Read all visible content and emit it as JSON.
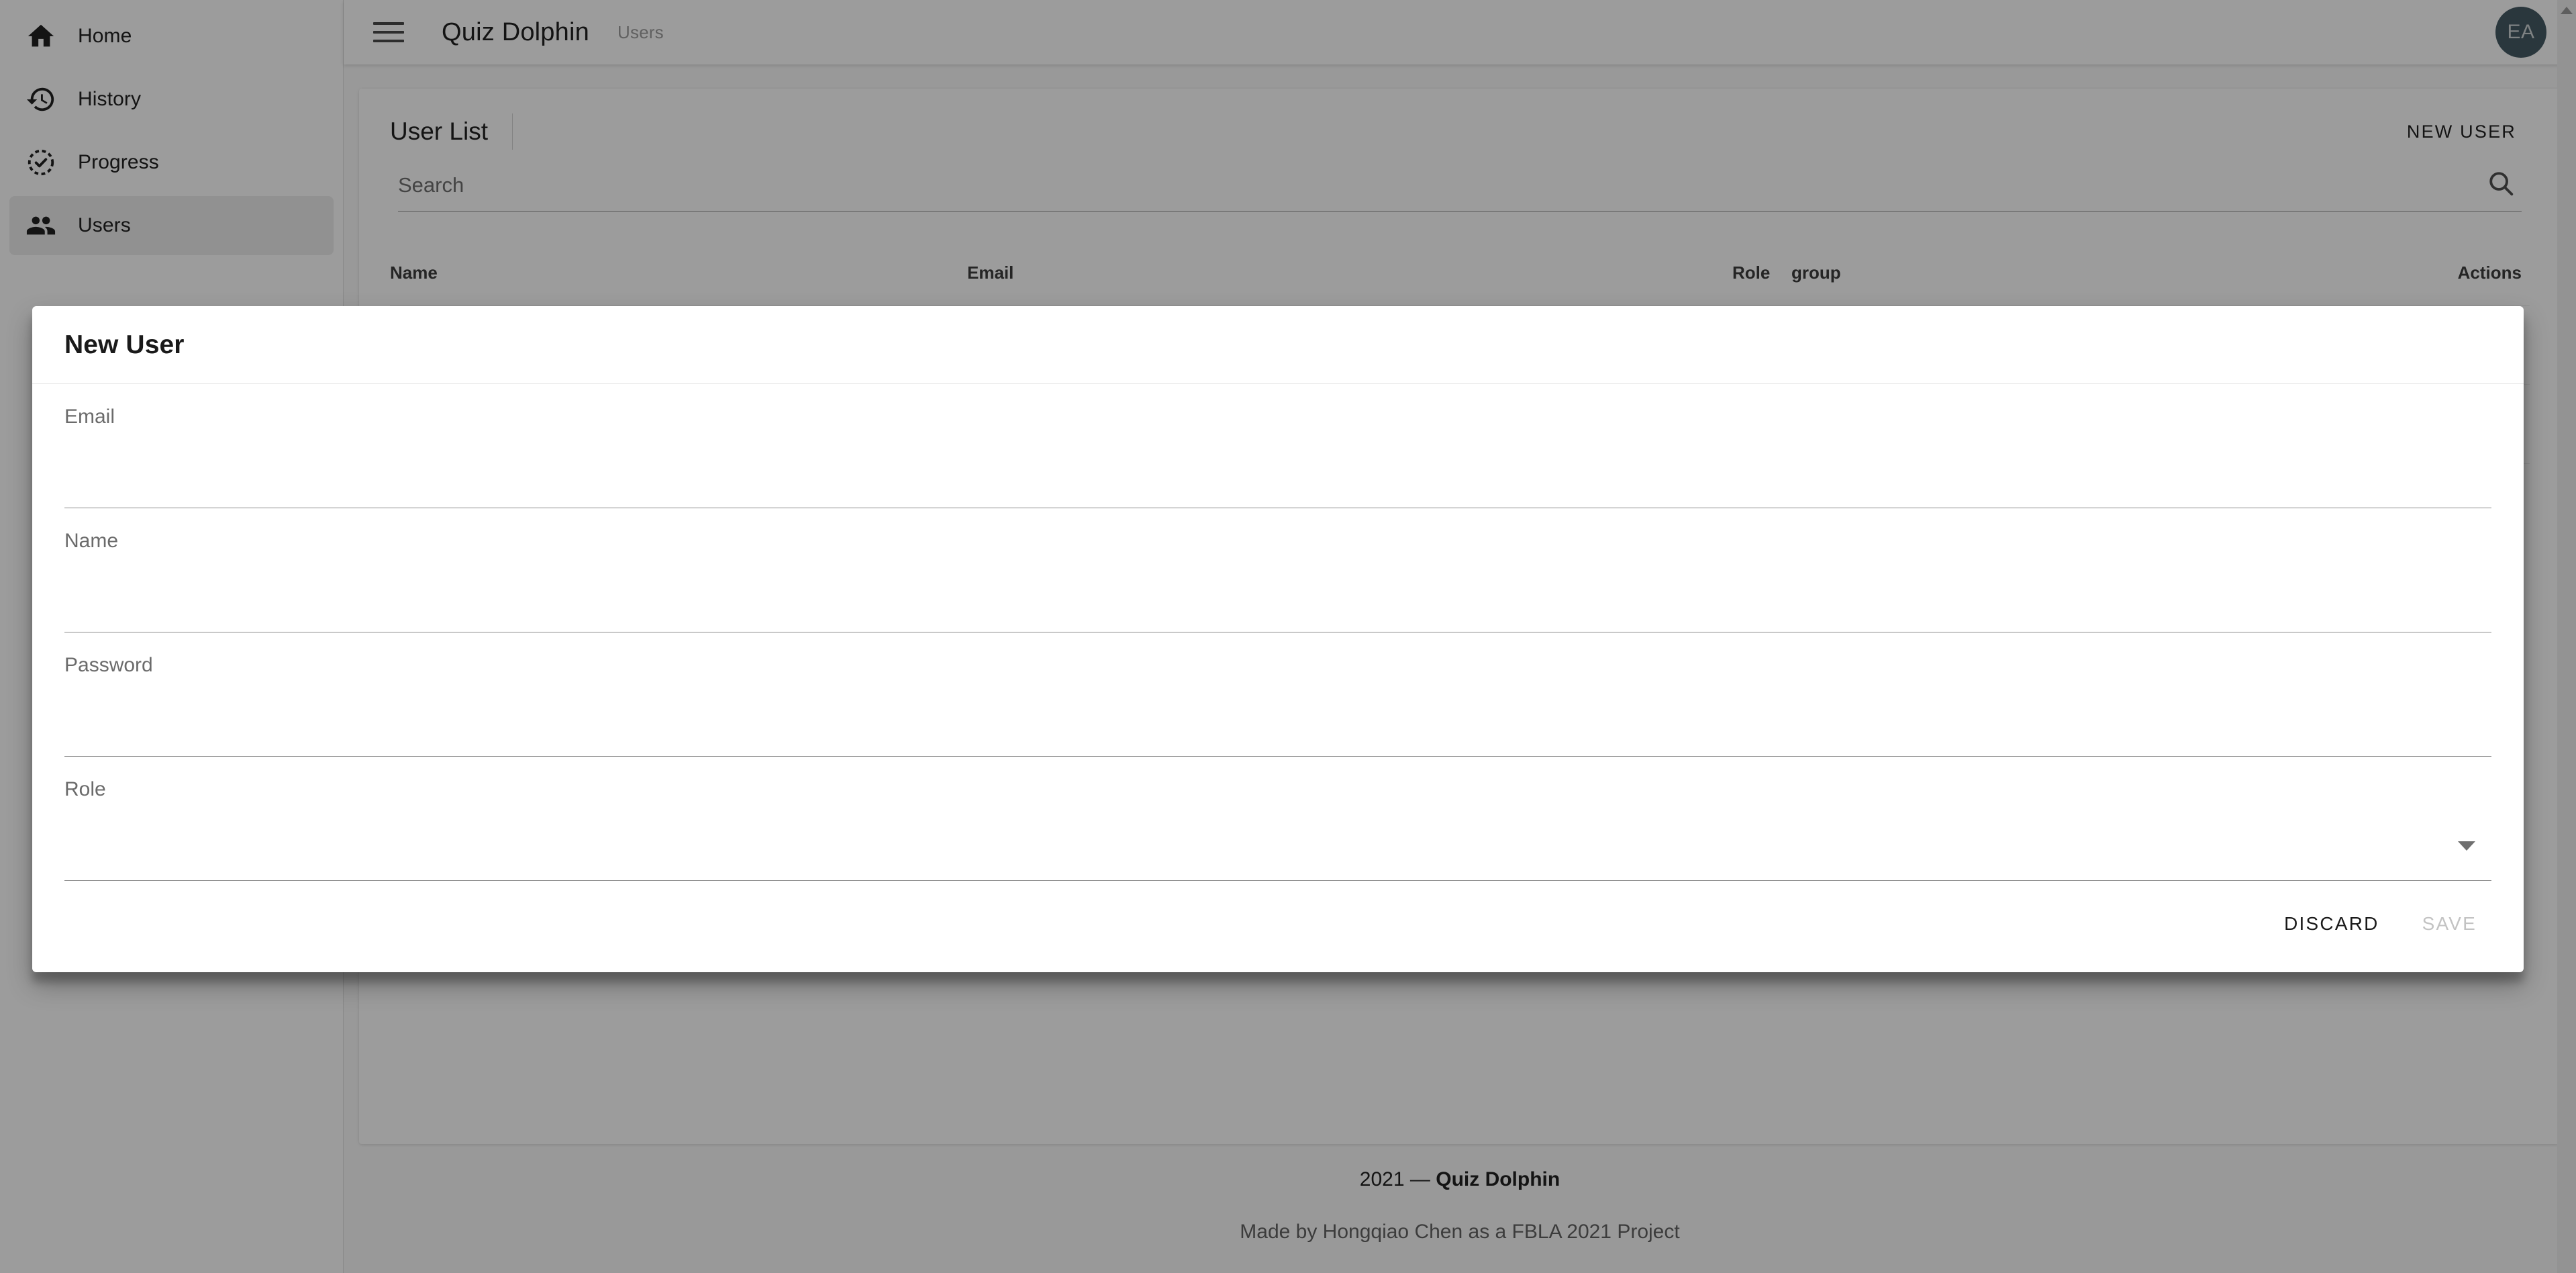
{
  "sidebar": {
    "items": [
      {
        "label": "Home",
        "icon": "home-icon",
        "active": false
      },
      {
        "label": "History",
        "icon": "history-icon",
        "active": false
      },
      {
        "label": "Progress",
        "icon": "progress-icon",
        "active": false
      },
      {
        "label": "Users",
        "icon": "users-icon",
        "active": true
      }
    ]
  },
  "appbar": {
    "menu_icon": "hamburger-icon",
    "title": "Quiz Dolphin",
    "subtitle": "Users",
    "avatar_initials": "EA",
    "avatar_color": "#455a64"
  },
  "user_list": {
    "title": "User List",
    "new_user_label": "NEW USER",
    "search": {
      "placeholder": "Search",
      "value": "",
      "icon": "search-icon"
    },
    "columns": [
      "Name",
      "Email",
      "Role",
      "group",
      "Actions"
    ],
    "rows": []
  },
  "footer": {
    "year": "2021",
    "dash": "—",
    "brand": "Quiz Dolphin",
    "credit": "Made by Hongqiao Chen as a FBLA 2021 Project"
  },
  "modal": {
    "title": "New User",
    "fields": [
      {
        "label": "Email",
        "value": "",
        "type": "text",
        "has_caret": false
      },
      {
        "label": "Name",
        "value": "",
        "type": "text",
        "has_caret": false
      },
      {
        "label": "Password",
        "value": "",
        "type": "password",
        "has_caret": false
      },
      {
        "label": "Role",
        "value": "",
        "type": "select",
        "has_caret": true
      }
    ],
    "discard_label": "DISCARD",
    "save_label": "SAVE",
    "save_enabled": false
  }
}
